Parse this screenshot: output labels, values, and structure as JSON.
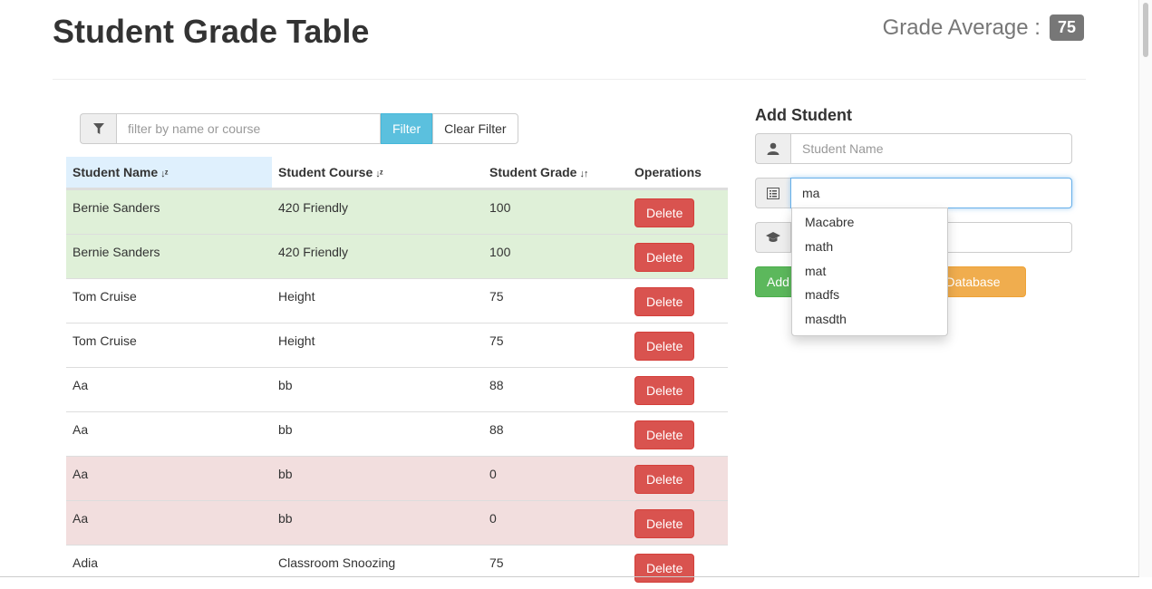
{
  "header": {
    "title": "Student Grade Table",
    "average_label": "Grade Average :",
    "average_value": "75"
  },
  "filter": {
    "placeholder": "filter by name or course",
    "value": "",
    "filter_label": "Filter",
    "clear_label": "Clear Filter",
    "icon": "filter-icon"
  },
  "table": {
    "columns": [
      {
        "label": "Student Name",
        "sort_icon": "sort-alpha-down-icon",
        "sorted": true
      },
      {
        "label": "Student Course",
        "sort_icon": "sort-alpha-down-icon"
      },
      {
        "label": "Student Grade",
        "sort_icon": "sort-icon"
      },
      {
        "label": "Operations"
      }
    ],
    "rows": [
      {
        "name": "Bernie Sanders",
        "course": "420 Friendly",
        "grade": "100",
        "status": "success"
      },
      {
        "name": "Bernie Sanders",
        "course": "420 Friendly",
        "grade": "100",
        "status": "success"
      },
      {
        "name": "Tom Cruise",
        "course": "Height",
        "grade": "75",
        "status": ""
      },
      {
        "name": "Tom Cruise",
        "course": "Height",
        "grade": "75",
        "status": ""
      },
      {
        "name": "Aa",
        "course": "bb",
        "grade": "88",
        "status": ""
      },
      {
        "name": "Aa",
        "course": "bb",
        "grade": "88",
        "status": ""
      },
      {
        "name": "Aa",
        "course": "bb",
        "grade": "0",
        "status": "danger"
      },
      {
        "name": "Aa",
        "course": "bb",
        "grade": "0",
        "status": "danger"
      },
      {
        "name": "Adia",
        "course": "Classroom Snoozing",
        "grade": "75",
        "status": ""
      }
    ],
    "delete_label": "Delete"
  },
  "add_form": {
    "title": "Add Student",
    "name_placeholder": "Student Name",
    "name_value": "",
    "course_value": "ma",
    "grade_value": "",
    "add_label": "Add",
    "db_label": "m Database",
    "icons": {
      "name": "user-icon",
      "course": "list-alt-icon",
      "grade": "education-icon"
    }
  },
  "autocomplete": {
    "items": [
      "Macabre",
      "math",
      "mat",
      "madfs",
      "masdth"
    ]
  },
  "colors": {
    "success_row": "#dff0d8",
    "danger_row": "#f2dede",
    "delete": "#d9534f",
    "filter": "#5bc0de",
    "add": "#5cb85c",
    "db": "#f0ad4e",
    "badge": "#777777"
  }
}
